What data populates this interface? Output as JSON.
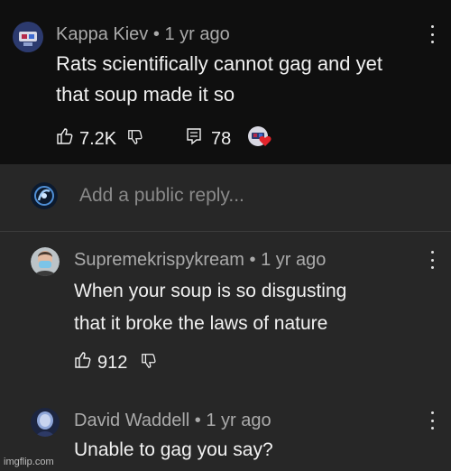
{
  "comment": {
    "author": "Kappa Kiev",
    "age": "1 yr ago",
    "text_line1": "Rats scientifically cannot gag and yet",
    "text_line2": "that soup made it so",
    "likes": "7.2K",
    "replies": "78"
  },
  "reply_box": {
    "placeholder": "Add a public reply..."
  },
  "replies": [
    {
      "author": "Supremekrispykream",
      "age": "1 yr ago",
      "text_line1": "When your soup is so disgusting",
      "text_line2": "that it broke the laws of nature",
      "likes": "912"
    },
    {
      "author": "David Waddell",
      "age": "1 yr ago",
      "text_line1": "Unable to gag you say?"
    }
  ],
  "watermark": "imgflip.com",
  "separator": "•",
  "colors": {
    "background": "#272727",
    "comment_background": "#0f0f0f",
    "meta_text": "#aaaaaa",
    "body_text": "#f1f1f1",
    "heart": "#e3242b"
  },
  "icons": [
    "thumbs-up-icon",
    "thumbs-down-icon",
    "comment-icon",
    "more-vert-icon",
    "creator-heart-icon"
  ]
}
